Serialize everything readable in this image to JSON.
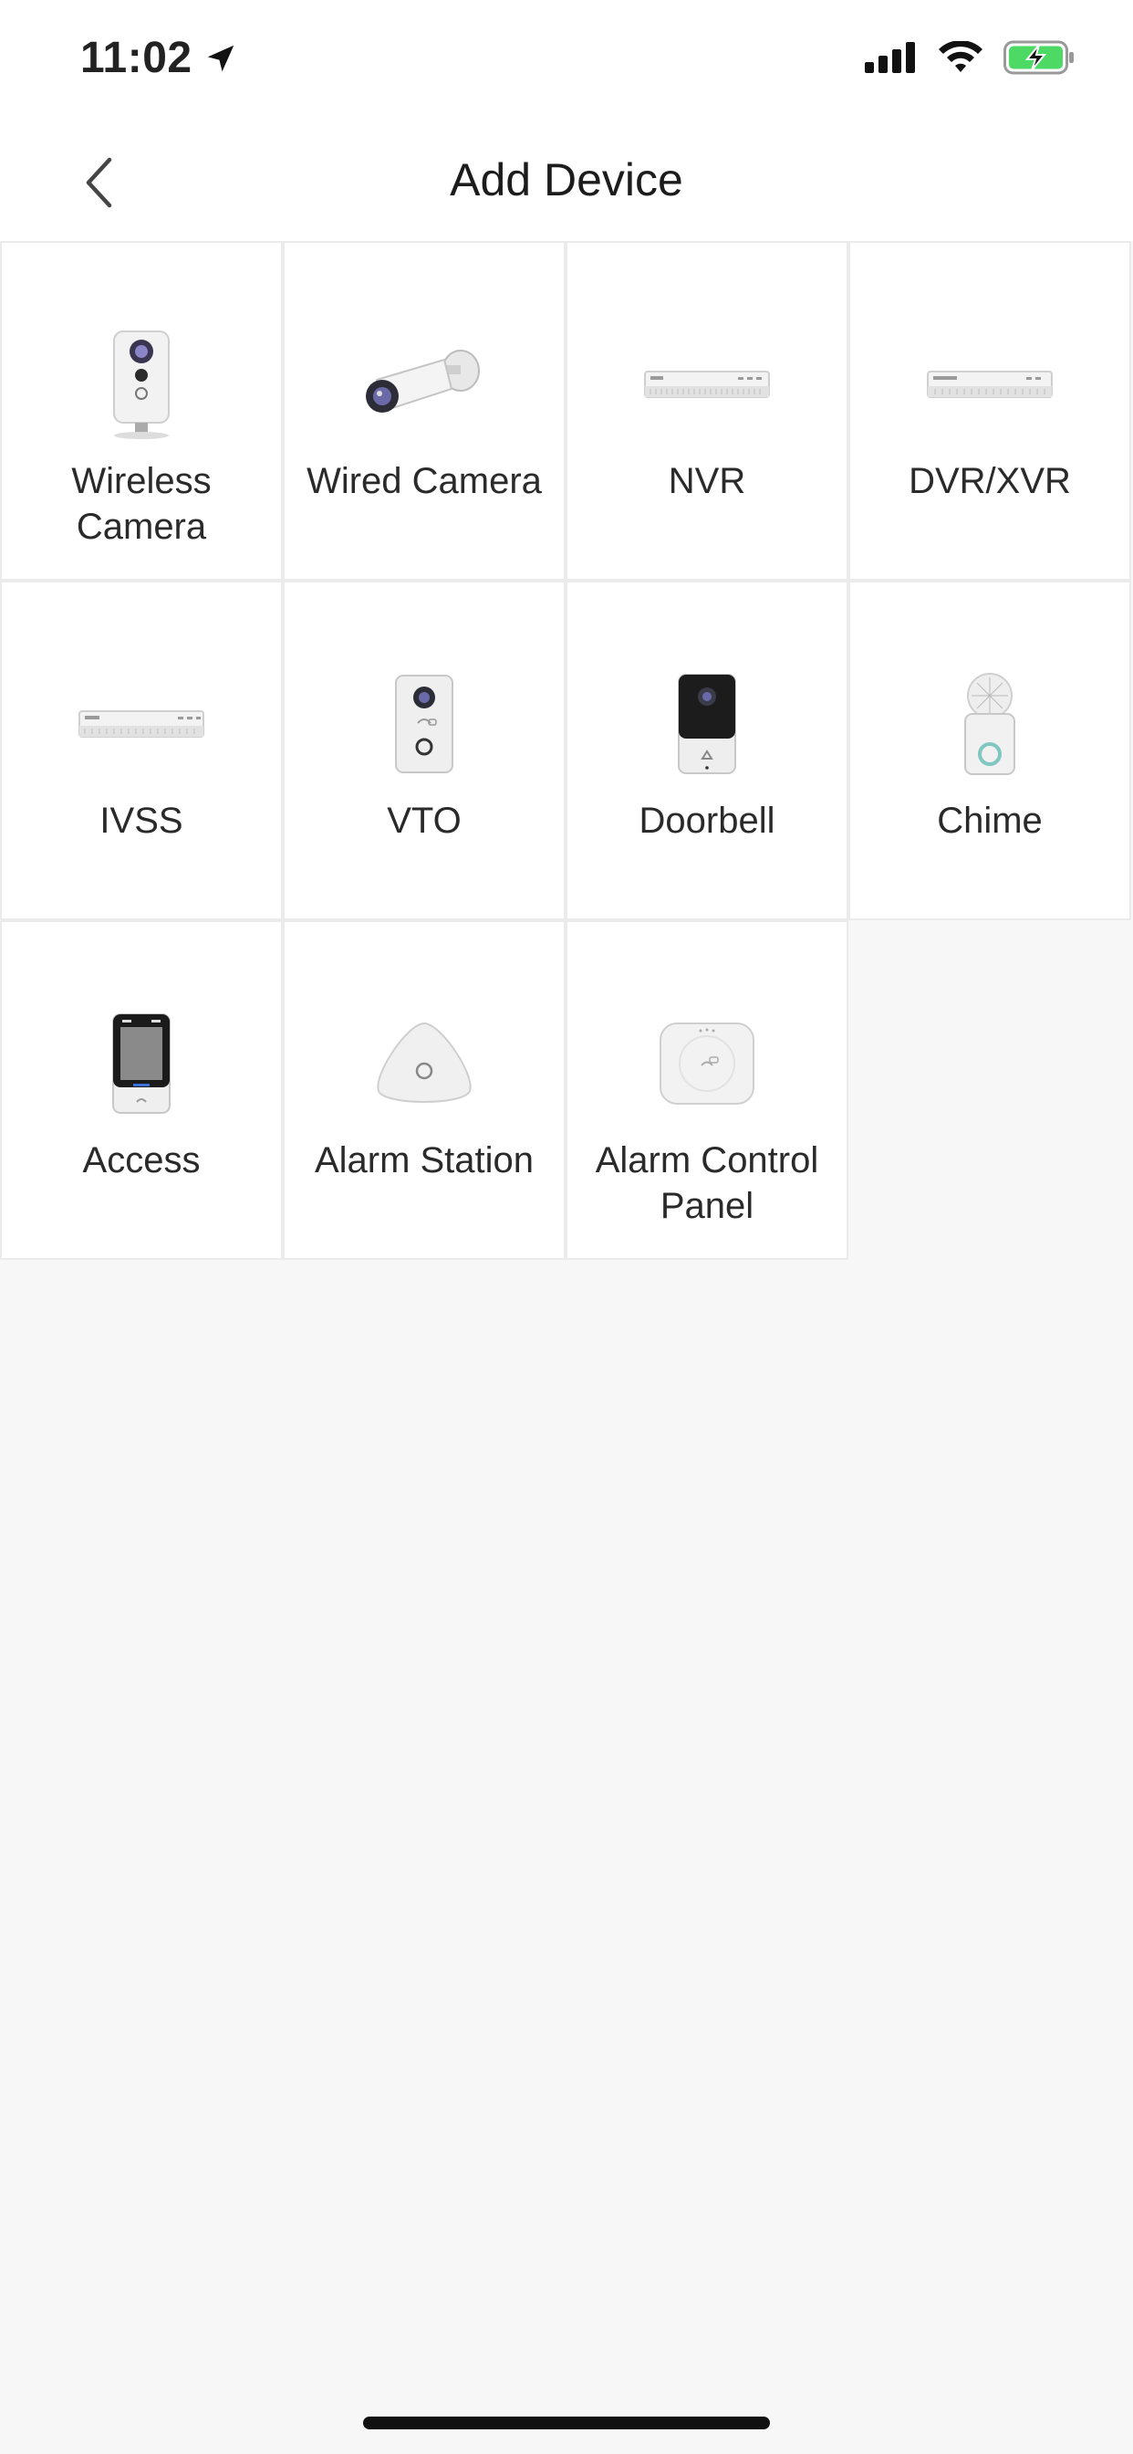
{
  "status_bar": {
    "time": "11:02",
    "icons": [
      "location-arrow-icon",
      "cellular-signal-icon",
      "wifi-icon",
      "battery-charging-icon"
    ]
  },
  "header": {
    "title": "Add Device",
    "back_icon": "chevron-left-icon"
  },
  "devices": [
    {
      "label": "Wireless Camera",
      "icon": "wireless-camera-icon"
    },
    {
      "label": "Wired Camera",
      "icon": "wired-camera-icon"
    },
    {
      "label": "NVR",
      "icon": "nvr-icon"
    },
    {
      "label": "DVR/XVR",
      "icon": "dvr-xvr-icon"
    },
    {
      "label": "IVSS",
      "icon": "ivss-icon"
    },
    {
      "label": "VTO",
      "icon": "vto-icon"
    },
    {
      "label": "Doorbell",
      "icon": "doorbell-icon"
    },
    {
      "label": "Chime",
      "icon": "chime-icon"
    },
    {
      "label": "Access",
      "icon": "access-icon"
    },
    {
      "label": "Alarm Station",
      "icon": "alarm-station-icon"
    },
    {
      "label": "Alarm Control Panel",
      "icon": "alarm-control-panel-icon"
    }
  ],
  "colors": {
    "background": "#f7f7f7",
    "tile": "#ffffff",
    "tile_border": "#ebebeb",
    "battery_green": "#4cd964"
  }
}
